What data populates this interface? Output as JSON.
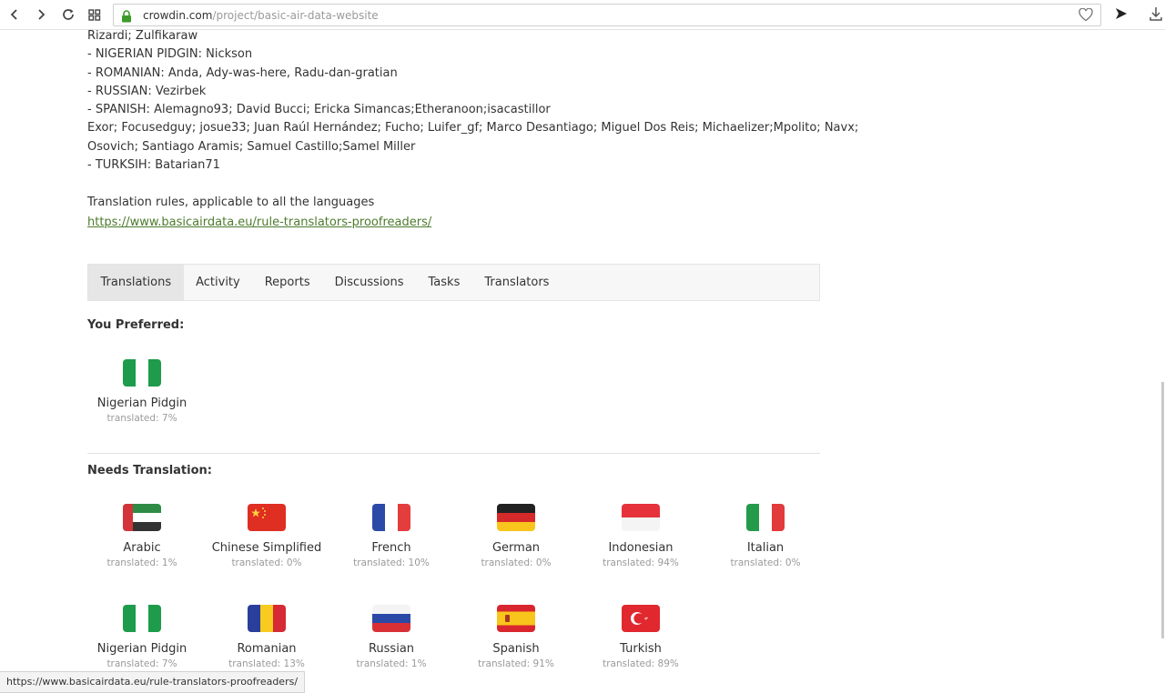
{
  "browser": {
    "url_host": "crowdin.com",
    "url_path": "/project/basic-air-data-website"
  },
  "description": {
    "lines": [
      "Rizardi; Zulfikaraw",
      "- NIGERIAN PIDGIN: Nickson",
      "- ROMANIAN: Anda, Ady-was-here, Radu-dan-gratian",
      "- RUSSIAN: Vezirbek",
      "- SPANISH: Alemagno93; David Bucci; Ericka Simancas;Etheranoon;isacastillor",
      "Exor; Focusedguy; josue33; Juan Raúl Hernández; Fucho; Luifer_gf; Marco Desantiago; Miguel Dos Reis; Michaelizer;Mpolito; Navx;",
      "Osovich; Santiago Aramis; Samuel Castillo;Samel Miller",
      "- TURKSIH: Batarian71",
      "",
      "Translation rules, applicable to all the languages"
    ],
    "rules_link": "https://www.basicairdata.eu/rule-translators-proofreaders/"
  },
  "tabs": [
    "Translations",
    "Activity",
    "Reports",
    "Discussions",
    "Tasks",
    "Translators"
  ],
  "preferred": {
    "title": "You Preferred:",
    "languages": [
      {
        "name": "Nigerian Pidgin",
        "progress": "translated: 7%",
        "flag": "nigeria-flag"
      }
    ]
  },
  "needs_translation": {
    "title": "Needs Translation:",
    "languages": [
      {
        "name": "Arabic",
        "progress": "translated: 1%",
        "flag": "uae-flag"
      },
      {
        "name": "Chinese Simplified",
        "progress": "translated: 0%",
        "flag": "china-flag"
      },
      {
        "name": "French",
        "progress": "translated: 10%",
        "flag": "france-flag"
      },
      {
        "name": "German",
        "progress": "translated: 0%",
        "flag": "germany-flag"
      },
      {
        "name": "Indonesian",
        "progress": "translated: 94%",
        "flag": "indonesia-flag"
      },
      {
        "name": "Italian",
        "progress": "translated: 0%",
        "flag": "italy-flag"
      },
      {
        "name": "Nigerian Pidgin",
        "progress": "translated: 7%",
        "flag": "nigeria-flag"
      },
      {
        "name": "Romanian",
        "progress": "translated: 13%",
        "flag": "romania-flag"
      },
      {
        "name": "Russian",
        "progress": "translated: 1%",
        "flag": "russia-flag"
      },
      {
        "name": "Spanish",
        "progress": "translated: 91%",
        "flag": "spain-flag"
      },
      {
        "name": "Turkish",
        "progress": "translated: 89%",
        "flag": "turkey-flag"
      }
    ]
  },
  "status_bar": {
    "text": "https://www.basicairdata.eu/rule-translators-proofreaders/"
  },
  "colors": {
    "link": "#4d7b2e",
    "active_tab": "#e6e6e6",
    "muted_text": "#9a9a9a"
  }
}
